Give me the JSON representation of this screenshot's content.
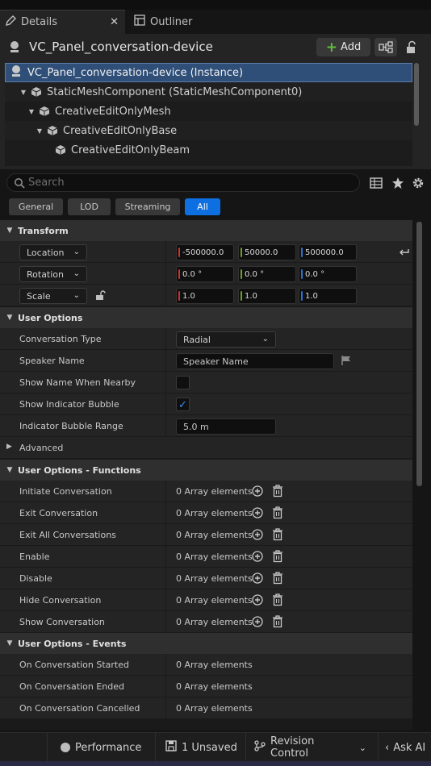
{
  "tabs": [
    {
      "label": "Details",
      "active": true
    },
    {
      "label": "Outliner",
      "active": false
    }
  ],
  "header": {
    "actor_name": "VC_Panel_conversation-device",
    "add_label": "Add"
  },
  "tree": [
    {
      "label": "VC_Panel_conversation-device (Instance)",
      "depth": 0,
      "selected": true
    },
    {
      "label": "StaticMeshComponent (StaticMeshComponent0)",
      "depth": 1
    },
    {
      "label": "CreativeEditOnlyMesh",
      "depth": 2
    },
    {
      "label": "CreativeEditOnlyBase",
      "depth": 3
    },
    {
      "label": "CreativeEditOnlyBeam",
      "depth": 4
    }
  ],
  "search": {
    "placeholder": "Search"
  },
  "filters": [
    {
      "label": "General",
      "active": false
    },
    {
      "label": "LOD",
      "active": false
    },
    {
      "label": "Streaming",
      "active": false
    },
    {
      "label": "All",
      "active": true
    }
  ],
  "transform": {
    "title": "Transform",
    "location": {
      "label": "Location",
      "x": "-500000.0",
      "y": "50000.0",
      "z": "500000.0"
    },
    "rotation": {
      "label": "Rotation",
      "x": "0.0 °",
      "y": "0.0 °",
      "z": "0.0 °"
    },
    "scale": {
      "label": "Scale",
      "x": "1.0",
      "y": "1.0",
      "z": "1.0"
    }
  },
  "user_options": {
    "title": "User Options",
    "conversation_type": {
      "label": "Conversation Type",
      "value": "Radial"
    },
    "speaker_name": {
      "label": "Speaker Name",
      "value": "Speaker Name"
    },
    "show_name": {
      "label": "Show Name When Nearby",
      "checked": false
    },
    "show_bubble": {
      "label": "Show Indicator Bubble",
      "checked": true
    },
    "bubble_range": {
      "label": "Indicator Bubble Range",
      "value": "5.0 m"
    }
  },
  "advanced": {
    "title": "Advanced"
  },
  "functions": {
    "title": "User Options - Functions",
    "value_text": "0 Array elements",
    "items": [
      {
        "label": "Initiate Conversation"
      },
      {
        "label": "Exit Conversation"
      },
      {
        "label": "Exit All Conversations"
      },
      {
        "label": "Enable"
      },
      {
        "label": "Disable"
      },
      {
        "label": "Hide Conversation"
      },
      {
        "label": "Show Conversation"
      }
    ]
  },
  "events": {
    "title": "User Options - Events",
    "value_text": "0 Array elements",
    "items": [
      {
        "label": "On Conversation Started"
      },
      {
        "label": "On Conversation Ended"
      },
      {
        "label": "On Conversation Cancelled"
      }
    ]
  },
  "statusbar": {
    "performance": "Performance",
    "unsaved": "1 Unsaved",
    "revision": "Revision Control",
    "ask_ai": "Ask AI"
  },
  "icons": [
    "pencil-icon",
    "close-icon",
    "outliner-icon",
    "actor-icon",
    "plus-icon",
    "blueprint-icon",
    "lock-icon",
    "cube-icon",
    "search-icon",
    "table-view-icon",
    "star-icon",
    "gear-icon",
    "reset-arrow-icon",
    "unlock-icon",
    "flag-icon",
    "add-circle-icon",
    "trash-icon",
    "save-icon",
    "branch-icon"
  ],
  "colors": {
    "accent": "#0d6fe0",
    "selection": "#2f4f78",
    "x_axis": "#c8372d",
    "y_axis": "#6ea029",
    "z_axis": "#2e6fd0"
  }
}
